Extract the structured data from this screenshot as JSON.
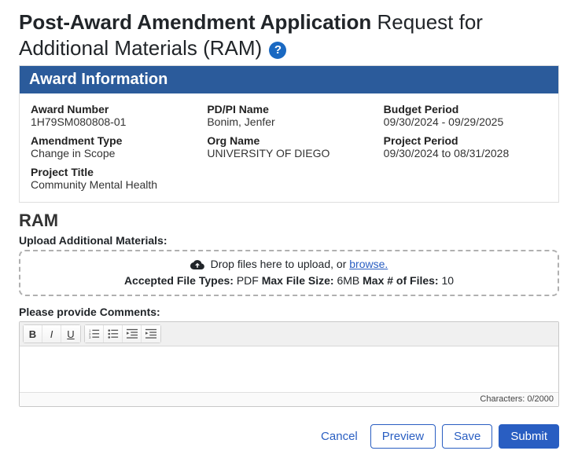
{
  "page": {
    "title_main": "Post-Award Amendment Application",
    "title_sub1": "Request for Additional Materials",
    "title_sub2": "(RAM)"
  },
  "panel": {
    "header": "Award Information"
  },
  "award": {
    "award_number_label": "Award Number",
    "award_number": "1H79SM080808-01",
    "pdpi_label": "PD/PI Name",
    "pdpi": "Bonim, Jenfer",
    "budget_period_label": "Budget Period",
    "budget_period": "09/30/2024 - 09/29/2025",
    "amendment_type_label": "Amendment Type",
    "amendment_type": "Change in Scope",
    "org_name_label": "Org Name",
    "org_name": "UNIVERSITY OF DIEGO",
    "project_period_label": "Project Period",
    "project_period": "09/30/2024 to 08/31/2028",
    "project_title_label": "Project Title",
    "project_title": "Community Mental Health"
  },
  "ram": {
    "heading": "RAM",
    "upload_label": "Upload Additional Materials:",
    "drop_text": "Drop files here to upload, or ",
    "browse": "browse.",
    "accepted_label": "Accepted File Types: ",
    "accepted_value": "PDF ",
    "maxsize_label": "Max File Size: ",
    "maxsize_value": "6MB ",
    "maxfiles_label": "Max # of Files: ",
    "maxfiles_value": "10",
    "comments_label": "Please provide Comments:",
    "char_prefix": "Characters: ",
    "char_count": "0/2000"
  },
  "actions": {
    "cancel": "Cancel",
    "preview": "Preview",
    "save": "Save",
    "submit": "Submit"
  }
}
